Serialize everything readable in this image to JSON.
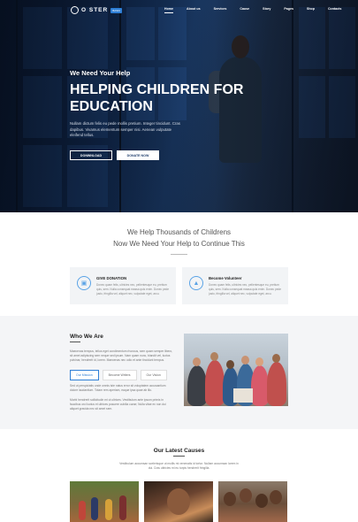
{
  "nav": {
    "logo_text": "O STER",
    "logo_badge": "BASIC",
    "menu": [
      "Home",
      "About us",
      "Services",
      "Cause",
      "Story",
      "Pages",
      "Shop",
      "Contacts"
    ]
  },
  "hero": {
    "kicker": "We Need Your Help",
    "title": "HELPING CHILDREN FOR EDUCATION",
    "description": "Nullam dictum felis eu pede mollis pretium. Integer tincidunt. Cras dapibus. Vivamus elementum semper nisi. Aenean vulputate eleifend tellus.",
    "btn_secondary": "DONWNLOAD",
    "btn_primary": "DONATE NOW"
  },
  "mission": {
    "line1": "We Help Thousands of Childrens",
    "line2": "Now We Need Your Help to Continue This"
  },
  "cards": [
    {
      "title": "GIVE DONATION",
      "text": "Donec quam felis, ultricies nec, pellentesque eu, pretium quis, sem. Nulla consequat massa quis enim. Donec pede justo, fringilla vel, aliquet nec, vulputate eget, arcu."
    },
    {
      "title": "Become Volunteer",
      "text": "Donec quam felis, ultricies nec, pellentesque eu, pretium quis, sem. Nulla consequat massa quis enim. Donec pede justo, fringilla vel, aliquet nec, vulputate eget, arcu."
    }
  ],
  "who": {
    "title": "Who We Are",
    "p1": "Maecenas tempus, tellus eget condimentum rhoncus, sem quam semper libero, sit amet adipiscing sem neque sed ipsum. Nam quam nunc, blandit vel, luctus pulvinar, hendrerit id, lorem. Maecenas nec odio et ante tincidunt tempus.",
    "tabs": [
      "Our Mission",
      "Become Writers",
      "Our Vision"
    ],
    "p2": "Sed ut perspiciatis unde omnis iste natus error sit voluptatem accusantium dolore laudantium. Totam rem aperiam, eaque ipsa quae ab illo.",
    "p3": "Morbi hendrerit sollicitudin mi ut ultrices. Vestibulum ante ipsum primis in faucibus orci luctus et ultrices posuere cubilia curae; Nulla vitae ex non dui aliquet gravida nec sit amet sem."
  },
  "causes": {
    "title": "Our Latest Causes",
    "description": "Vestibulum accumsan scelerisque ut mollis mi venenatis id tortor. Nullam accumsan lorem in dui. Cras ultricies mi eu turpis hendrerit fringilla."
  }
}
